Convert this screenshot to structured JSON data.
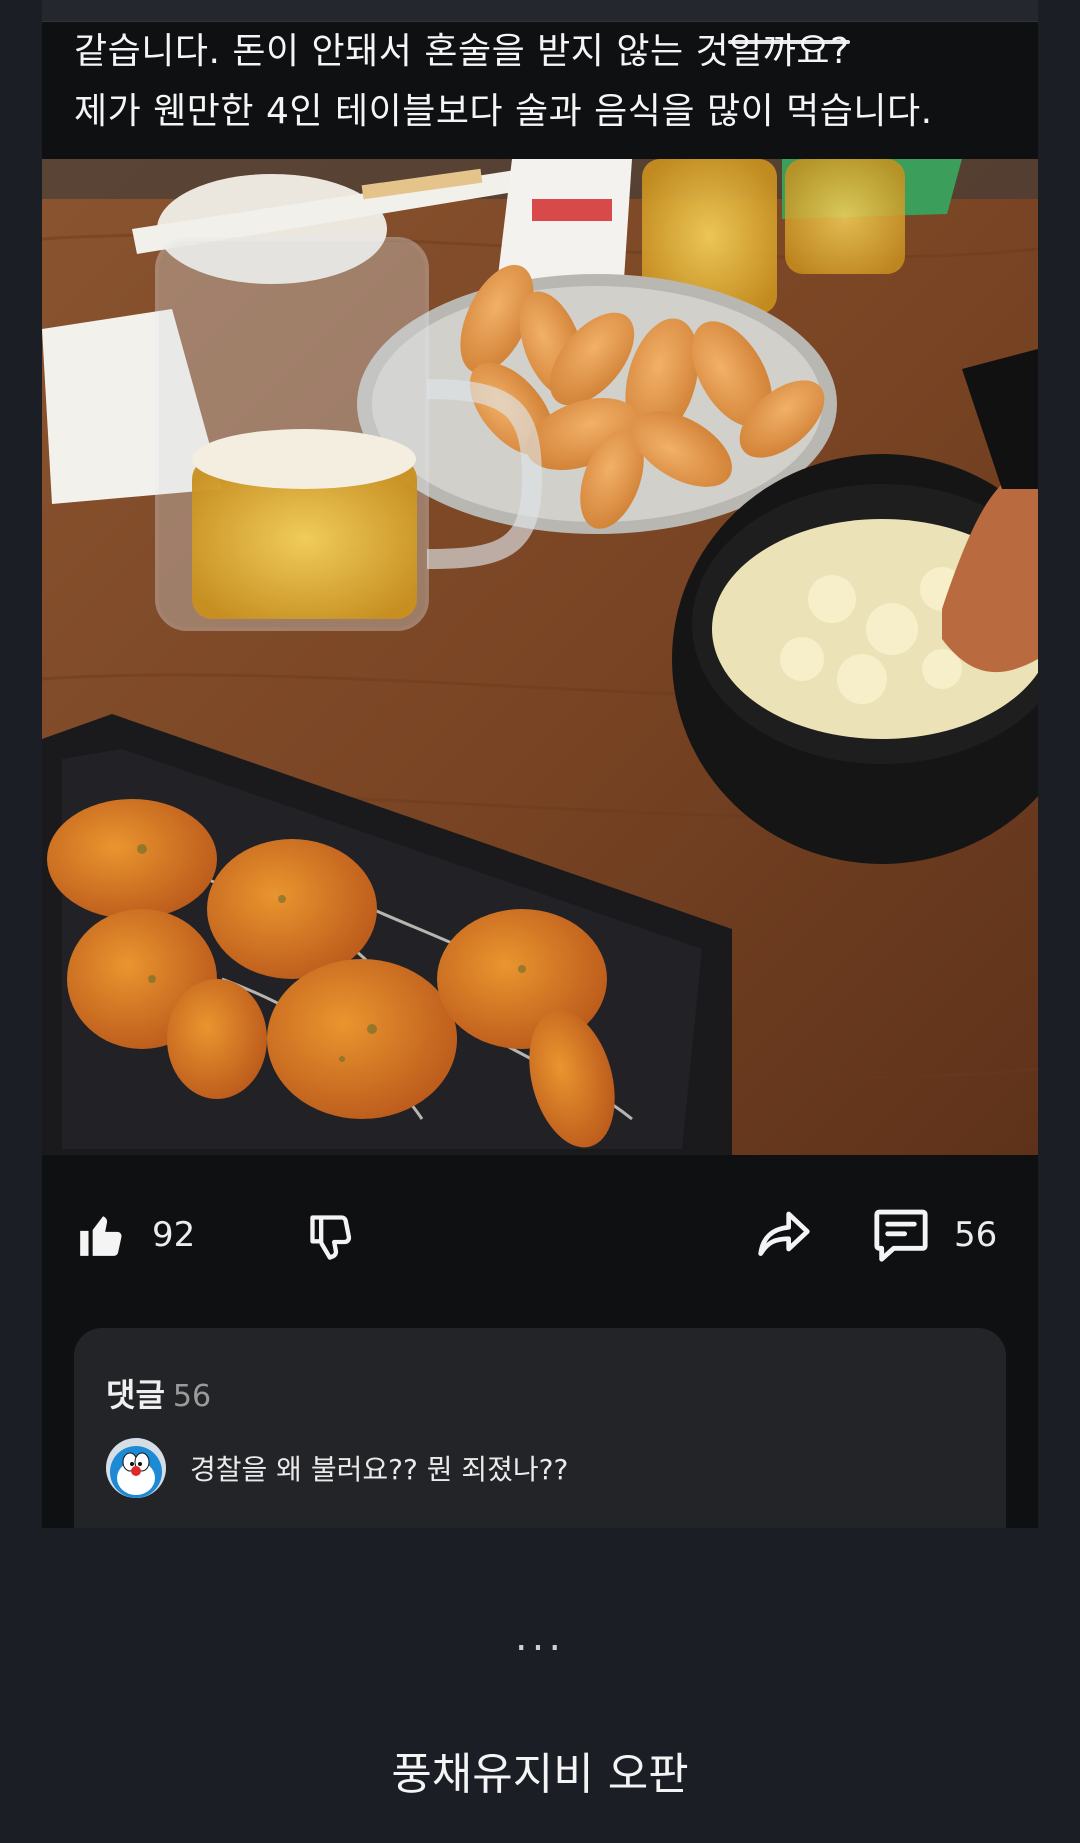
{
  "post": {
    "lines": [
      "같습니다. 돈이 안돼서 혼술을 받지 않는 것일까요?",
      "제가 웬만한 4인 테이블보다 술과 음식을 많이 먹습니다."
    ]
  },
  "actions": {
    "likes": "92",
    "comments": "56"
  },
  "comments": {
    "title": "댓글",
    "count": "56",
    "first": {
      "text": "경찰을 왜 불러요?? 뭔 죄졌나??"
    }
  },
  "footer": {
    "ellipsis": "...",
    "caption": "풍채유지비 오판"
  },
  "icons": [
    "thumbs-up-icon",
    "thumbs-down-icon",
    "share-icon",
    "comment-icon",
    "avatar"
  ],
  "colors": {
    "panel": "#0f1012",
    "page": "#1b1e24",
    "comment_box": "#232427"
  }
}
